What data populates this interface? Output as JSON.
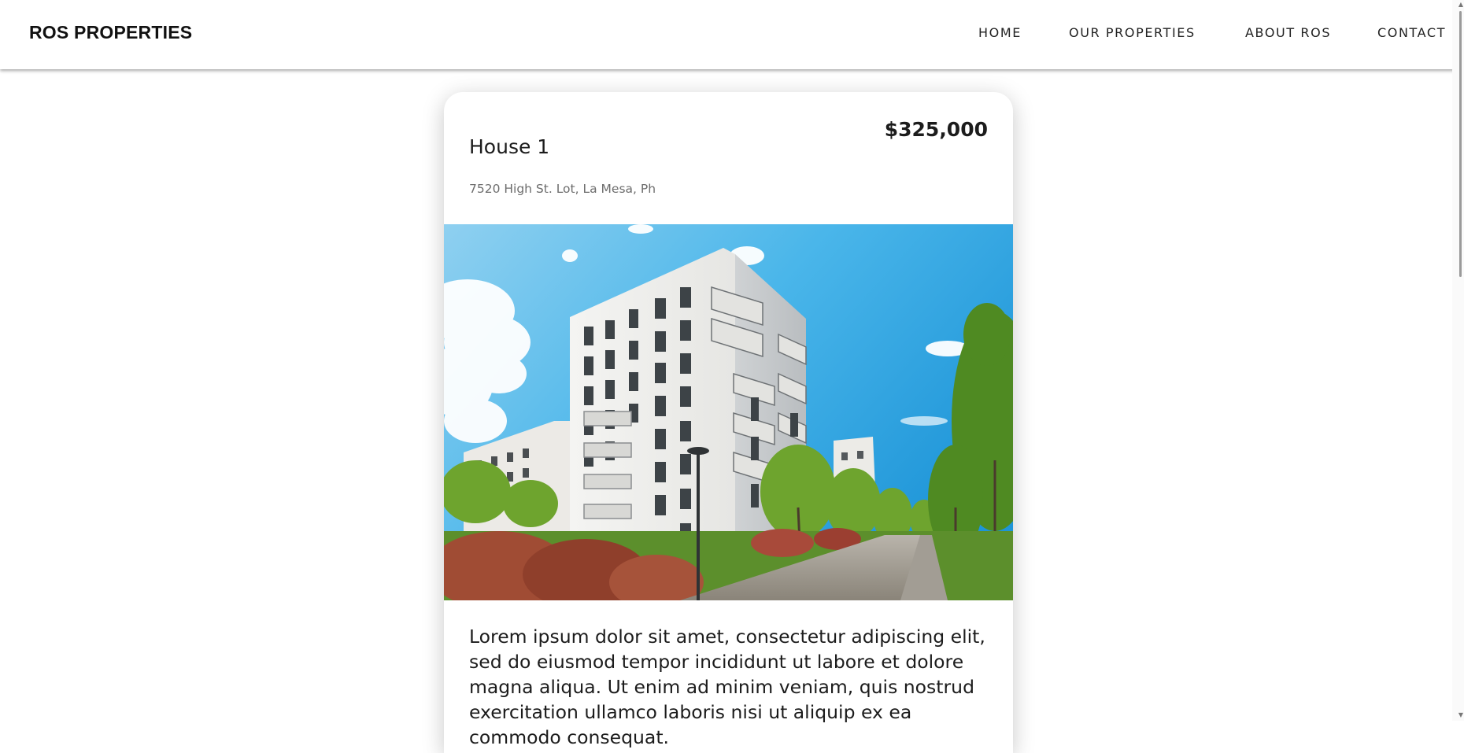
{
  "header": {
    "brand": "ROS PROPERTIES",
    "nav": [
      {
        "label": "HOME"
      },
      {
        "label": "OUR PROPERTIES"
      },
      {
        "label": "ABOUT ROS"
      },
      {
        "label": "CONTACT"
      }
    ]
  },
  "property": {
    "title": "House 1",
    "price": "$325,000",
    "address": "7520 High St. Lot, La Mesa, Ph",
    "image_alt": "White apartment building with balconies beside a tree-lined path",
    "description": "Lorem ipsum dolor sit amet, consectetur adipiscing elit, sed do eiusmod tempor incididunt ut labore et dolore magna aliqua. Ut enim ad minim veniam, quis nostrud exercitation ullamco laboris nisi ut aliquip ex ea commodo consequat."
  }
}
